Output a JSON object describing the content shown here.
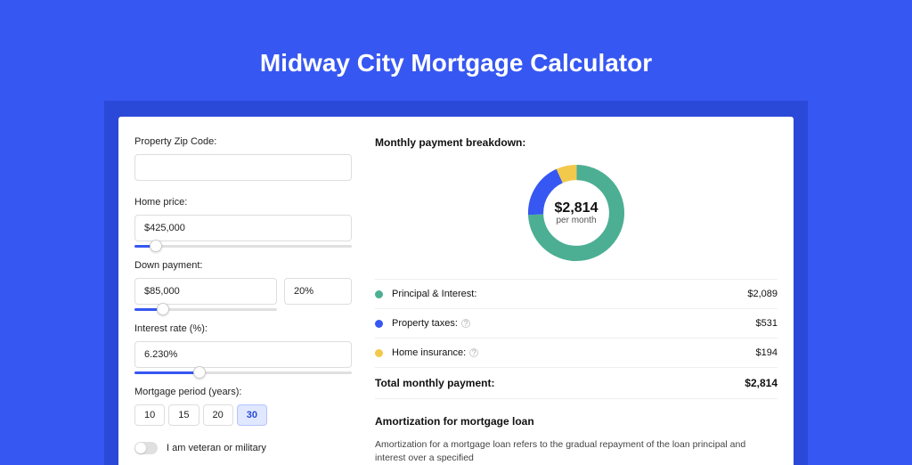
{
  "page_title": "Midway City Mortgage Calculator",
  "form": {
    "zip_label": "Property Zip Code:",
    "zip_value": "",
    "home_price_label": "Home price:",
    "home_price_value": "$425,000",
    "home_price_slider_pct": 10,
    "down_payment_label": "Down payment:",
    "down_payment_value": "$85,000",
    "down_payment_pct_value": "20%",
    "down_payment_slider_pct": 20,
    "interest_label": "Interest rate (%):",
    "interest_value": "6.230%",
    "interest_slider_pct": 30,
    "period_label": "Mortgage period (years):",
    "periods": [
      "10",
      "15",
      "20",
      "30"
    ],
    "period_selected": "30",
    "veteran_label": "I am veteran or military",
    "veteran_on": false
  },
  "breakdown": {
    "title": "Monthly payment breakdown:",
    "total_amount": "$2,814",
    "total_sub": "per month",
    "items": [
      {
        "name": "Principal & Interest:",
        "value": "$2,089",
        "color": "#4caf93",
        "info": false
      },
      {
        "name": "Property taxes:",
        "value": "$531",
        "color": "#3757f2",
        "info": true
      },
      {
        "name": "Home insurance:",
        "value": "$194",
        "color": "#f3c94b",
        "info": true
      }
    ],
    "total_label": "Total monthly payment:",
    "total_value": "$2,814"
  },
  "amortization": {
    "title": "Amortization for mortgage loan",
    "body": "Amortization for a mortgage loan refers to the gradual repayment of the loan principal and interest over a specified"
  },
  "chart_data": {
    "type": "pie",
    "title": "Monthly payment breakdown",
    "series": [
      {
        "name": "Principal & Interest",
        "value": 2089,
        "color": "#4caf93"
      },
      {
        "name": "Property taxes",
        "value": 531,
        "color": "#3757f2"
      },
      {
        "name": "Home insurance",
        "value": 194,
        "color": "#f3c94b"
      }
    ],
    "total": 2814,
    "center_label": "$2,814",
    "center_sub": "per month"
  }
}
